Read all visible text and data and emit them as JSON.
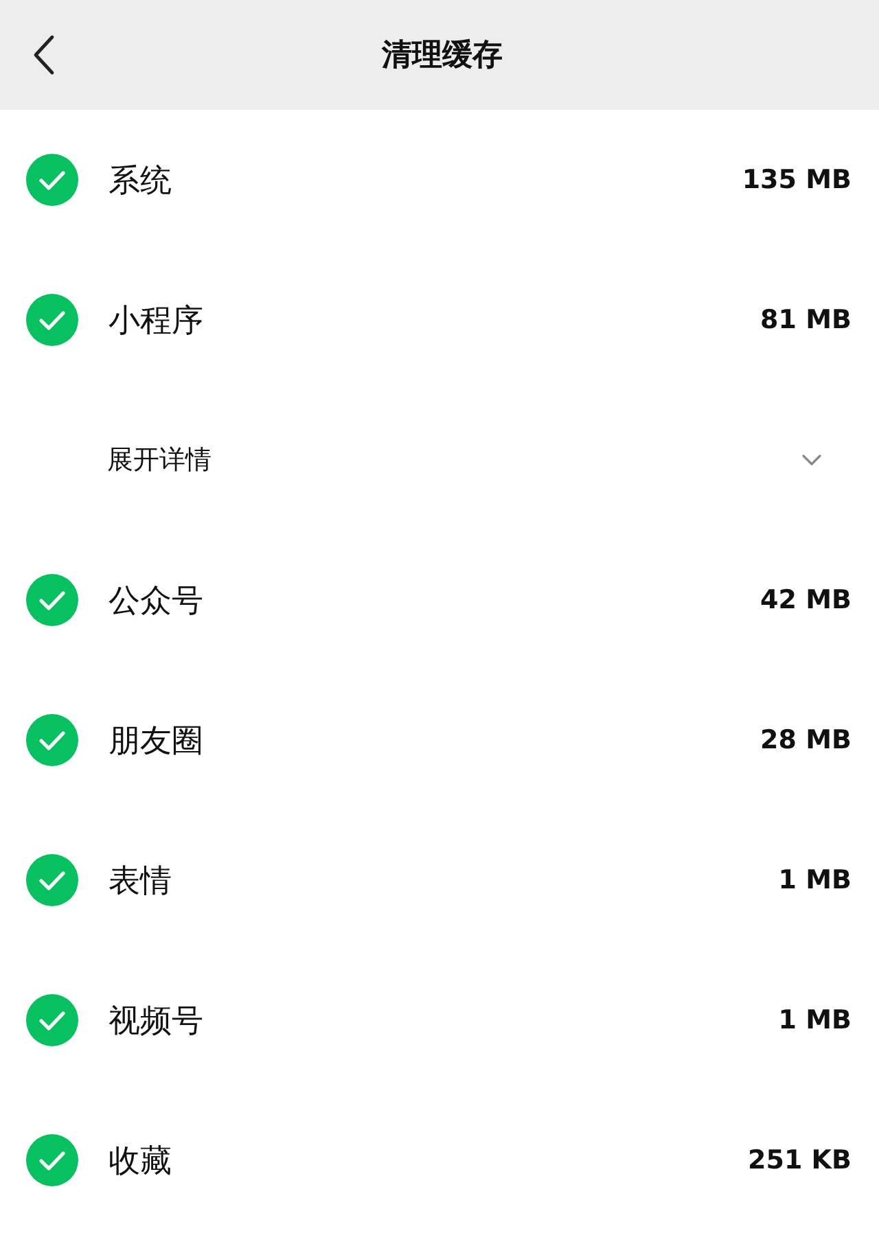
{
  "header": {
    "title": "清理缓存"
  },
  "items": [
    {
      "kind": "item",
      "label": "系统",
      "size": "135 MB",
      "checked": true
    },
    {
      "kind": "item",
      "label": "小程序",
      "size": "81 MB",
      "checked": true
    },
    {
      "kind": "expand",
      "label": "展开详情",
      "expanded": false
    },
    {
      "kind": "item",
      "label": "公众号",
      "size": "42 MB",
      "checked": true
    },
    {
      "kind": "item",
      "label": "朋友圈",
      "size": "28 MB",
      "checked": true
    },
    {
      "kind": "item",
      "label": "表情",
      "size": "1 MB",
      "checked": true
    },
    {
      "kind": "item",
      "label": "视频号",
      "size": "1 MB",
      "checked": true
    },
    {
      "kind": "item",
      "label": "收藏",
      "size": "251 KB",
      "checked": true
    }
  ]
}
